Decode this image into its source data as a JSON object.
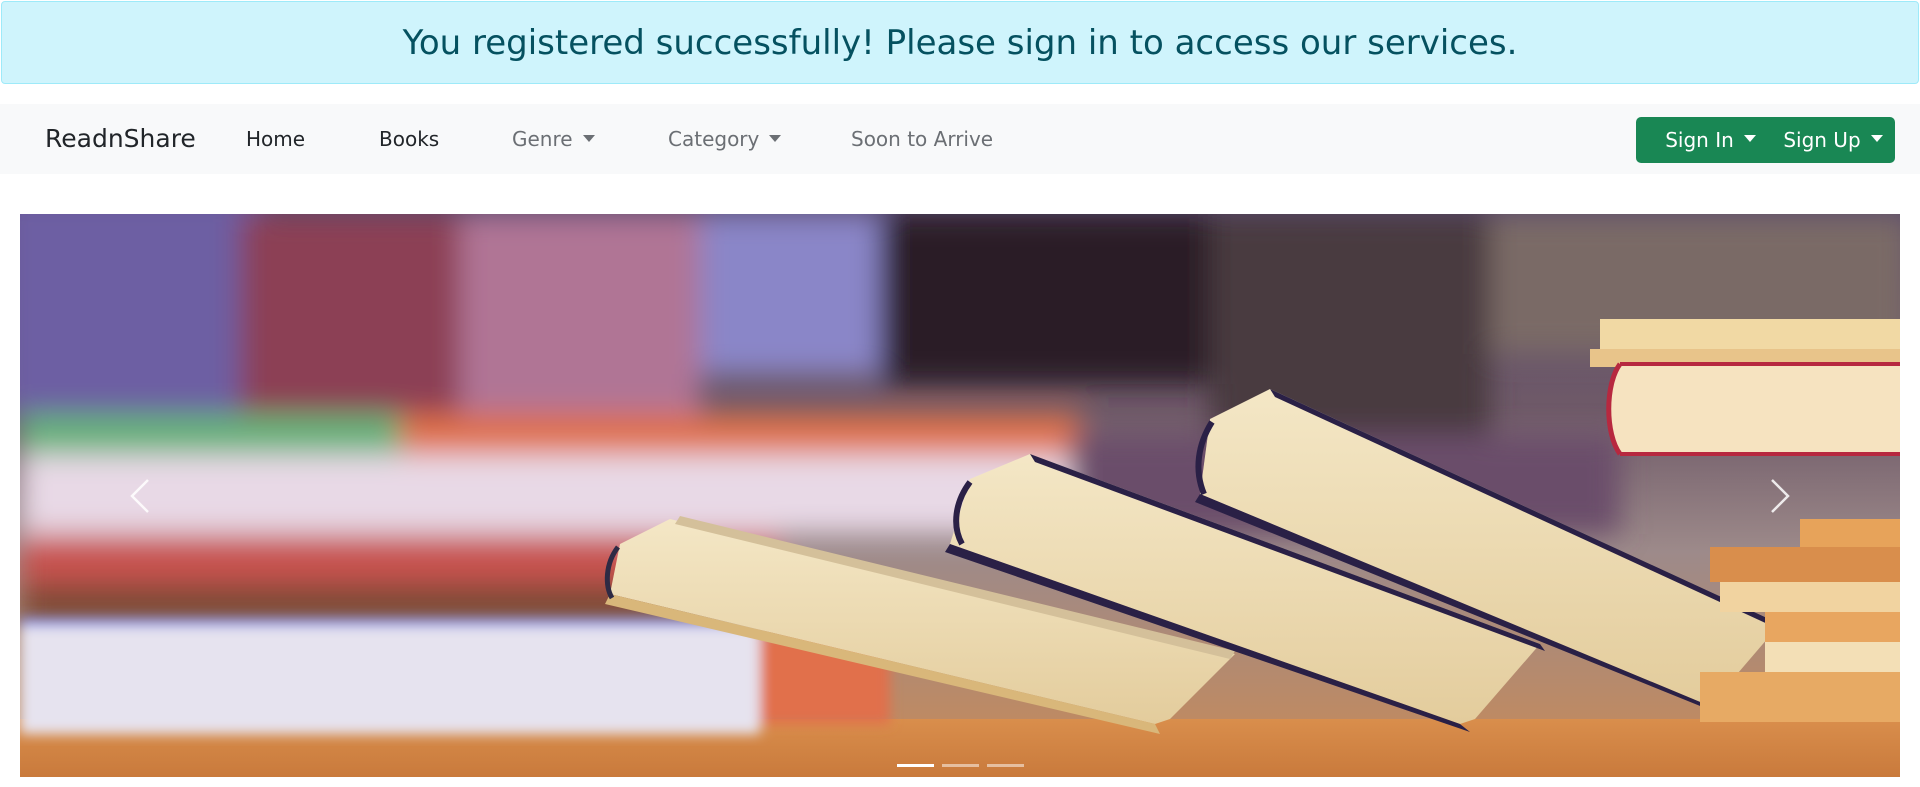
{
  "alert": {
    "message": "You registered successfully! Please sign in to access our services."
  },
  "navbar": {
    "brand": "ReadnShare",
    "links": [
      {
        "label": "Home"
      },
      {
        "label": "Books"
      },
      {
        "label": "Genre",
        "dropdown": true
      },
      {
        "label": "Category",
        "dropdown": true
      },
      {
        "label": "Soon to Arrive"
      }
    ],
    "buttons": [
      {
        "label": "Sign In",
        "dropdown": true
      },
      {
        "label": "Sign Up",
        "dropdown": true
      }
    ]
  },
  "carousel": {
    "slide_count": 3,
    "active_slide": 1,
    "image_subject": "books"
  },
  "icons": {
    "prev": "chevron-left-icon",
    "next": "chevron-right-icon",
    "caret": "caret-down-icon"
  },
  "colors": {
    "alert_bg": "#cff4fc",
    "alert_text": "#055160",
    "navbar_bg": "#f8f9fa",
    "button_bg": "#198754",
    "button_text": "#ffffff"
  }
}
